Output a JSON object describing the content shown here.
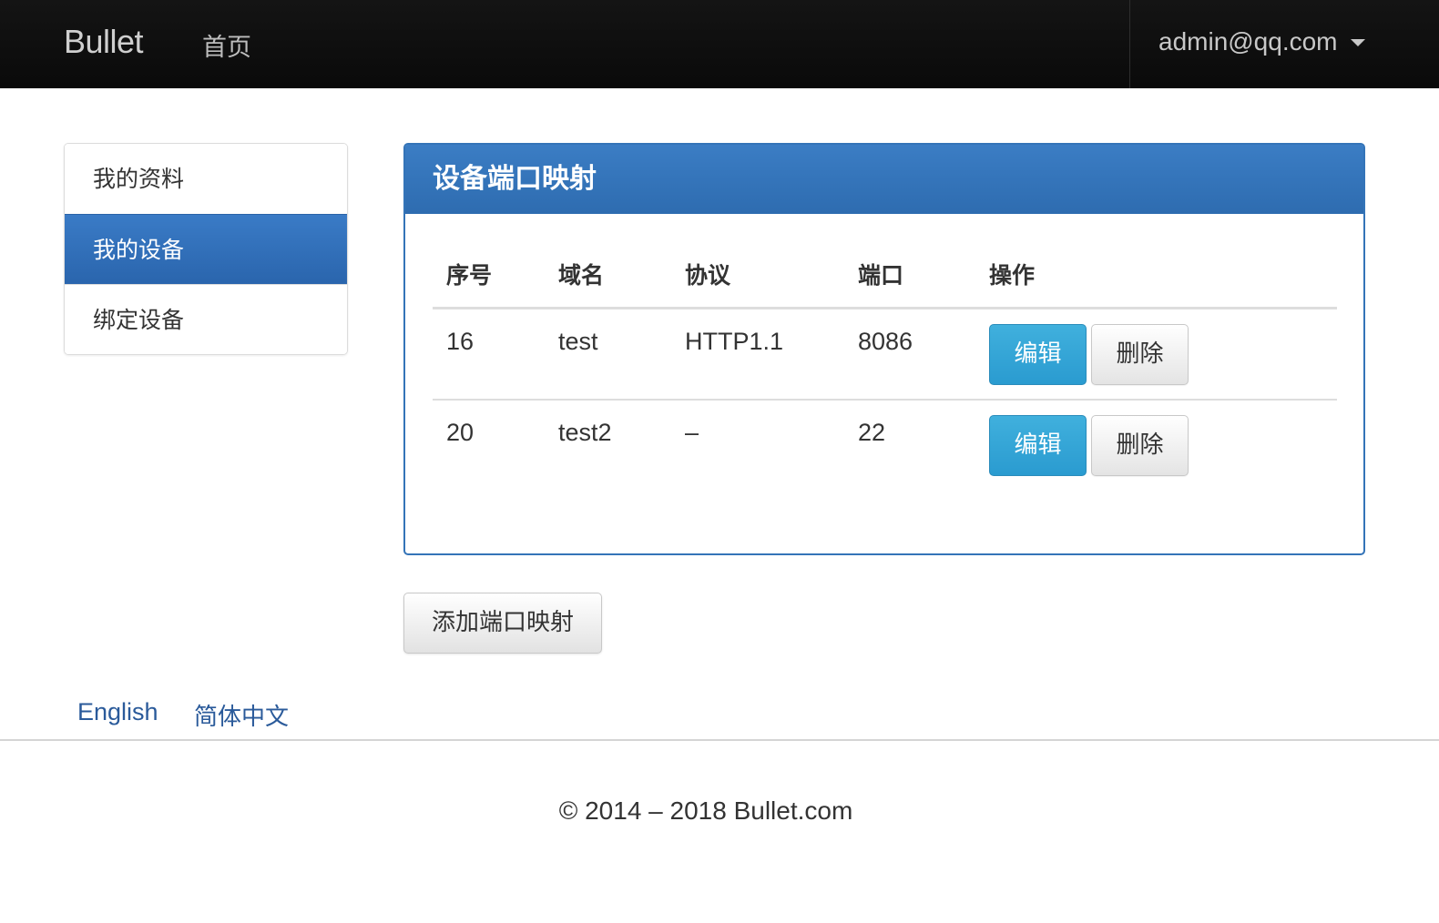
{
  "navbar": {
    "brand": "Bullet",
    "home": "首页",
    "user_email": "admin@qq.com"
  },
  "sidebar": {
    "items": [
      {
        "label": "我的资料",
        "active": false
      },
      {
        "label": "我的设备",
        "active": true
      },
      {
        "label": "绑定设备",
        "active": false
      }
    ]
  },
  "panel": {
    "title": "设备端口映射",
    "columns": [
      "序号",
      "域名",
      "协议",
      "端口",
      "操作"
    ],
    "rows": [
      {
        "id": "16",
        "domain": "test",
        "protocol": "HTTP1.1",
        "port": "8086",
        "edit_label": "编辑",
        "delete_label": "删除"
      },
      {
        "id": "20",
        "domain": "test2",
        "protocol": "–",
        "port": "22",
        "edit_label": "编辑",
        "delete_label": "删除"
      }
    ]
  },
  "add_button": "添加端口映射",
  "footer": {
    "lang_en": "English",
    "lang_zh": "简体中文",
    "copyright": "© 2014 – 2018 Bullet.com"
  },
  "colors": {
    "navbar_bg": "#0e0e0e",
    "primary": "#3474b8",
    "info_button": "#2a9bd0",
    "link": "#2a5a9a"
  }
}
